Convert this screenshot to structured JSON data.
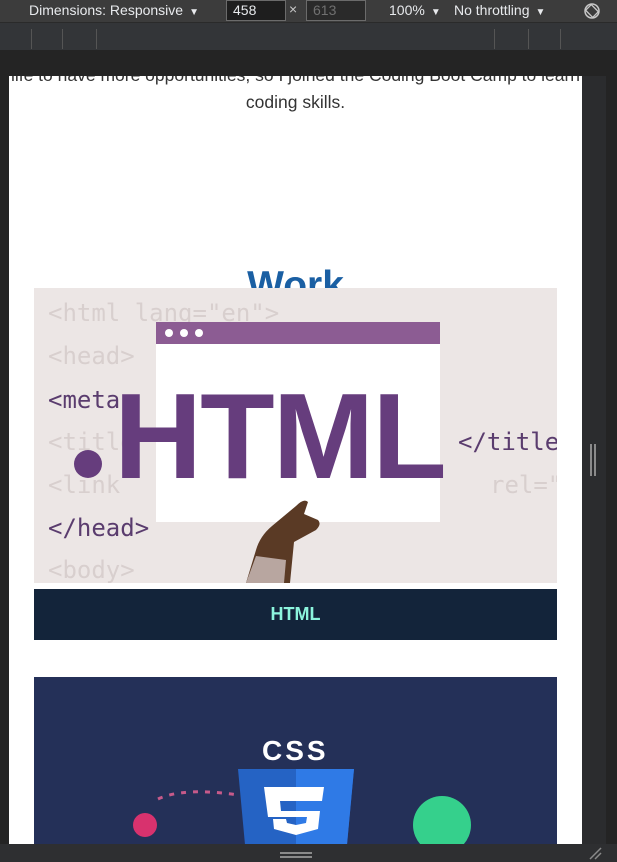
{
  "devtools": {
    "dimensions_label": "Dimensions: Responsive",
    "width_value": "458",
    "height_value": "613",
    "times": "×",
    "zoom": "100%",
    "throttling": "No throttling"
  },
  "page": {
    "about_text": "life to have more opportunities, so I joined the Coding Boot Camp to learn coding skills.",
    "section_title": "Work",
    "projects": [
      {
        "caption": "HTML",
        "image_word": "HTML",
        "code_lines": [
          "<html lang=\"en\">",
          "<head>",
          "<meta",
          "<title",
          "</title",
          "<link",
          "rel=\"",
          "</head>",
          "<body>"
        ]
      },
      {
        "image_word": "CSS"
      }
    ]
  },
  "colors": {
    "title_blue": "#1a5fa3",
    "caption_bg": "#13243a",
    "caption_text": "#8cf5dd",
    "html_purple": "#663d7d",
    "css_bg": "#243058"
  }
}
